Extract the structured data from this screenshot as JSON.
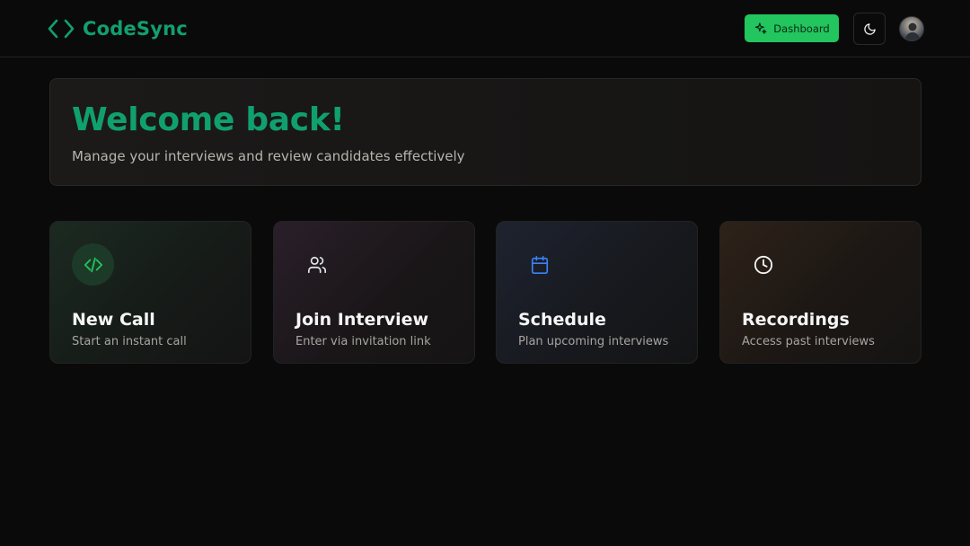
{
  "navbar": {
    "brand": "CodeSync",
    "brand_icon": "code-brackets-icon",
    "dashboard_label": "Dashboard",
    "dashboard_icon": "sparkles-icon",
    "theme_icon": "moon-icon",
    "accent_color": "#22c55e"
  },
  "welcome": {
    "title": "Welcome back!",
    "subtitle": "Manage your interviews and review candidates effectively"
  },
  "actions": [
    {
      "title": "New Call",
      "description": "Start an instant call",
      "icon": "code-icon",
      "color": "#22c55e"
    },
    {
      "title": "Join Interview",
      "description": "Enter via invitation link",
      "icon": "users-icon",
      "color": "#e5e7eb"
    },
    {
      "title": "Schedule",
      "description": "Plan upcoming interviews",
      "icon": "calendar-icon",
      "color": "#3b82f6"
    },
    {
      "title": "Recordings",
      "description": "Access past interviews",
      "icon": "clock-icon",
      "color": "#f3f4f6"
    }
  ]
}
